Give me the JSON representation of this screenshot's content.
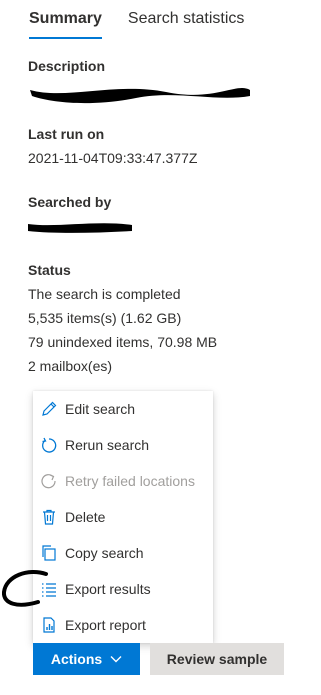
{
  "tabs": [
    {
      "label": "Summary",
      "active": true
    },
    {
      "label": "Search statistics",
      "active": false
    }
  ],
  "details": {
    "description_label": "Description",
    "last_run_label": "Last run on",
    "last_run_value": "2021-11-04T09:33:47.377Z",
    "searched_by_label": "Searched by",
    "status_label": "Status",
    "status_lines": [
      "The search is completed",
      "5,535 items(s) (1.62 GB)",
      "79 unindexed items, 70.98 MB",
      "2 mailbox(es)"
    ]
  },
  "menu": {
    "items": [
      {
        "label": "Edit search",
        "icon": "pencil-icon",
        "disabled": false
      },
      {
        "label": "Rerun search",
        "icon": "refresh-icon",
        "disabled": false
      },
      {
        "label": "Retry failed locations",
        "icon": "retry-icon",
        "disabled": true
      },
      {
        "label": "Delete",
        "icon": "trash-icon",
        "disabled": false
      },
      {
        "label": "Copy search",
        "icon": "copy-icon",
        "disabled": false
      },
      {
        "label": "Export results",
        "icon": "list-icon",
        "disabled": false
      },
      {
        "label": "Export report",
        "icon": "report-icon",
        "disabled": false
      }
    ]
  },
  "buttons": {
    "actions_label": "Actions",
    "review_label": "Review sample"
  },
  "colors": {
    "accent": "#0078d4",
    "secondary_button": "#e1dfdd",
    "disabled_text": "#a19f9d"
  }
}
